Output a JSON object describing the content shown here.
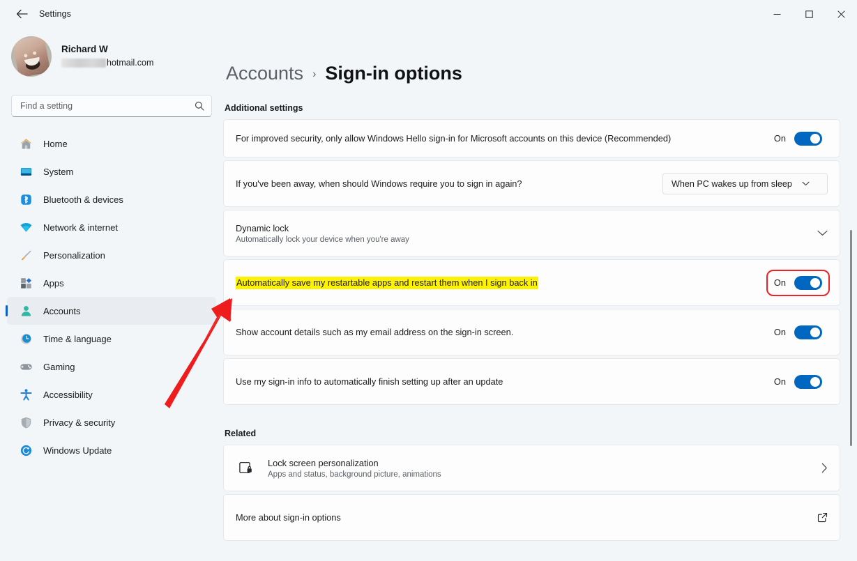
{
  "window": {
    "title": "Settings",
    "back_icon": "back-arrow-icon",
    "minimize_label": "Minimize",
    "maximize_label": "Maximize",
    "close_label": "Close"
  },
  "sidebar": {
    "profile": {
      "name": "Richard W",
      "email_visible": "hotmail.com",
      "email_redacted": true
    },
    "search": {
      "placeholder": "Find a setting",
      "value": "",
      "icon": "search-icon"
    },
    "items": [
      {
        "label": "Home",
        "icon": "home-icon",
        "selected": false
      },
      {
        "label": "System",
        "icon": "system-icon",
        "selected": false
      },
      {
        "label": "Bluetooth & devices",
        "icon": "bluetooth-icon",
        "selected": false
      },
      {
        "label": "Network & internet",
        "icon": "wifi-icon",
        "selected": false
      },
      {
        "label": "Personalization",
        "icon": "paintbrush-icon",
        "selected": false
      },
      {
        "label": "Apps",
        "icon": "apps-icon",
        "selected": false
      },
      {
        "label": "Accounts",
        "icon": "account-person-icon",
        "selected": true
      },
      {
        "label": "Time & language",
        "icon": "clock-icon",
        "selected": false
      },
      {
        "label": "Gaming",
        "icon": "gamepad-icon",
        "selected": false
      },
      {
        "label": "Accessibility",
        "icon": "accessibility-icon",
        "selected": false
      },
      {
        "label": "Privacy & security",
        "icon": "shield-icon",
        "selected": false
      },
      {
        "label": "Windows Update",
        "icon": "update-refresh-icon",
        "selected": false
      }
    ]
  },
  "breadcrumb": {
    "parent": "Accounts",
    "separator": "›",
    "current": "Sign-in options"
  },
  "sections": {
    "additional_heading": "Additional settings",
    "related_heading": "Related"
  },
  "settings": {
    "hello_only": {
      "label": "For improved security, only allow Windows Hello sign-in for Microsoft accounts on this device (Recommended)",
      "state_label": "On",
      "state": true
    },
    "require_signin": {
      "label": "If you've been away, when should Windows require you to sign in again?",
      "selected_option": "When PC wakes up from sleep",
      "chevron": "chevron-down-icon"
    },
    "dynamic_lock": {
      "title": "Dynamic lock",
      "subtitle": "Automatically lock your device when you're away",
      "chevron": "chevron-down-icon"
    },
    "restartable_apps": {
      "label": "Automatically save my restartable apps and restart them when I sign back in",
      "state_label": "On",
      "state": true,
      "highlighted": true,
      "annotated": true
    },
    "show_account_details": {
      "label": "Show account details such as my email address on the sign-in screen.",
      "state_label": "On",
      "state": true
    },
    "finish_setup": {
      "label": "Use my sign-in info to automatically finish setting up after an update",
      "state_label": "On",
      "state": true
    }
  },
  "related": {
    "lock_screen": {
      "title": "Lock screen personalization",
      "subtitle": "Apps and status, background picture, animations",
      "icon": "lock-screen-icon",
      "chevron": "chevron-right-icon"
    },
    "more_about": {
      "title": "More about sign-in options",
      "icon": "external-link-icon"
    }
  },
  "annotations": {
    "arrow_color": "#ee1c1c",
    "box_color": "#ee2222",
    "highlight_color": "#fff200"
  },
  "colors": {
    "accent": "#0067c0",
    "selection_bar": "#0c5ec9",
    "page_bg": "#f3f6f9",
    "card_bg": "#fdfdfd"
  }
}
